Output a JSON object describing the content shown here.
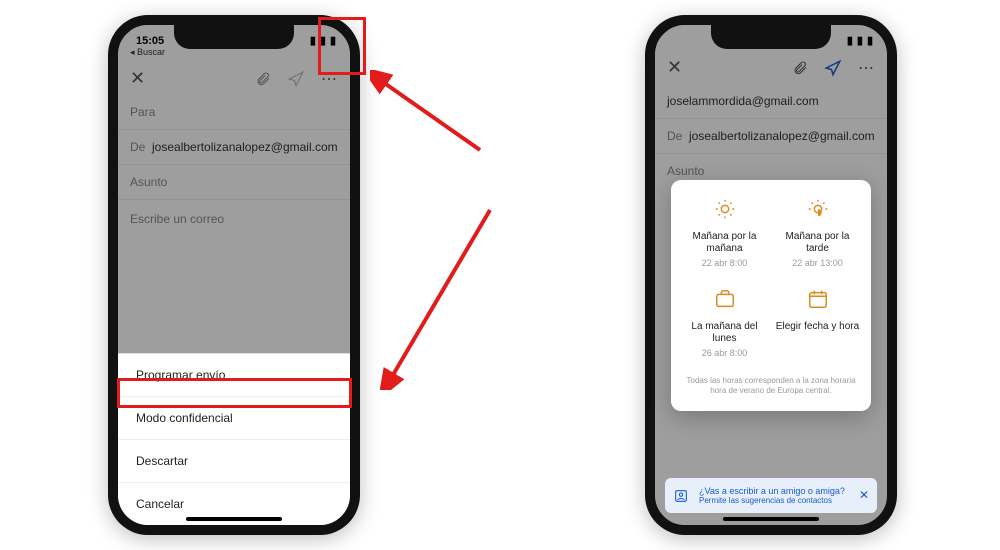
{
  "colors": {
    "annotation": "#e21b1b",
    "accent_orange": "#d98b1f",
    "link_blue": "#1a5bd0"
  },
  "phone_left": {
    "status_time": "15:05",
    "back_label": "Buscar",
    "compose": {
      "to_label": "Para",
      "from_label": "De",
      "from_value": "josealbertolizanalopez@gmail.com",
      "subject_label": "Asunto",
      "body_placeholder": "Escribe un correo"
    },
    "sheet": {
      "items": [
        {
          "label": "Programar envío"
        },
        {
          "label": "Modo confidencial"
        },
        {
          "label": "Descartar"
        },
        {
          "label": "Cancelar"
        }
      ]
    }
  },
  "phone_right": {
    "compose": {
      "to_value": "joselammordida@gmail.com",
      "from_label": "De",
      "from_value": "josealbertolizanalopez@gmail.com",
      "subject_label": "Asunto"
    },
    "schedule": {
      "options": [
        {
          "icon": "sun",
          "title": "Mañana por la mañana",
          "date": "22 abr 8:00"
        },
        {
          "icon": "sunset",
          "title": "Mañana por la tarde",
          "date": "22 abr 13:00"
        },
        {
          "icon": "briefcase",
          "title": "La mañana del lunes",
          "date": "26 abr 8:00"
        },
        {
          "icon": "calendar",
          "title": "Elegir fecha y hora",
          "date": ""
        }
      ],
      "timezone_note": "Todas las horas corresponden a la zona horaria hora de verano de Europa central."
    },
    "banner": {
      "title": "¿Vas a escribir a un amigo o amiga?",
      "subtitle": "Permite las sugerencias de contactos"
    }
  }
}
